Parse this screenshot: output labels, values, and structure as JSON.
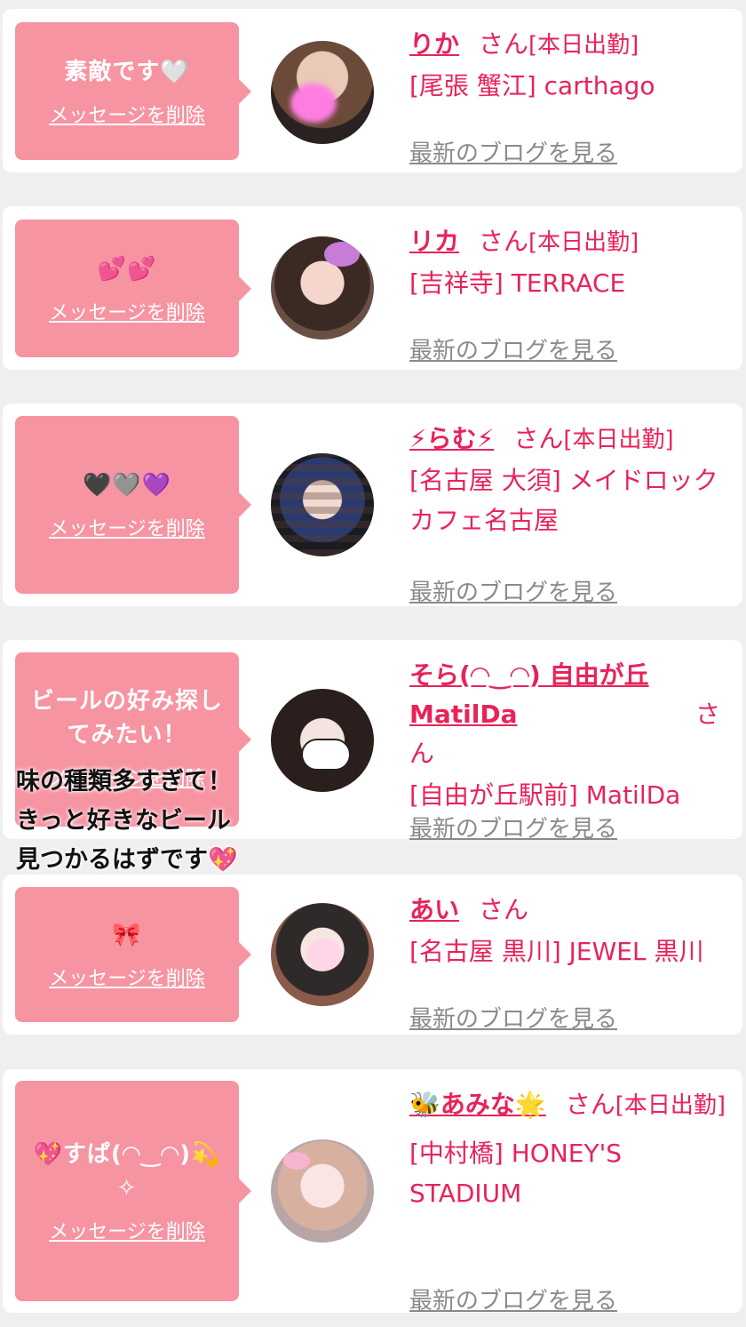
{
  "items": [
    {
      "message": "素敵です🤍",
      "delete_label": "メッセージを削除",
      "name": "りか",
      "san": "さん",
      "shift": "[本日出勤]",
      "shop": "[尾張 蟹江] carthago",
      "blog": "最新のブログを見る"
    },
    {
      "message": "💕💕",
      "delete_label": "メッセージを削除",
      "name": "リカ",
      "san": "さん",
      "shift": "[本日出勤]",
      "shop": "[吉祥寺] TERRACE",
      "blog": "最新のブログを見る"
    },
    {
      "message": "🖤🩶💜",
      "delete_label": "メッセージを削除",
      "name": "⚡らむ⚡",
      "san": "さん",
      "shift": "[本日出勤]",
      "shop": "[名古屋 大須] メイドロックカフェ名古屋",
      "blog": "最新のブログを見る"
    },
    {
      "message": "ビールの好み探してみたい！",
      "delete_label": "メッセージを削除",
      "name": "そら(◠‿◠) 自由が丘MatilDa",
      "san": "さん",
      "shift": "",
      "shop": "[自由が丘駅前] MatilDa",
      "blog": "最新のブログを見る"
    },
    {
      "message": "🎀",
      "delete_label": "メッセージを削除",
      "name": "あい",
      "san": "さん",
      "shift": "",
      "shop": "[名古屋 黒川] JEWEL 黒川",
      "blog": "最新のブログを見る"
    },
    {
      "message": "💖すぱ(◠‿◠)💫 ✧",
      "delete_label": "メッセージを削除",
      "name": "🐝あみな🌟",
      "san": "さん",
      "shift": "[本日出勤]",
      "shop": "[中村橋] HONEY'S STADIUM",
      "blog": "最新のブログを見る"
    }
  ],
  "overlay_text": {
    "line1": "味の種類多すぎて！",
    "line2": "きっと好きなビール",
    "line3": "見つかるはずです💖"
  },
  "colors": {
    "accent": "#e8235a",
    "bubble": "#f694a2",
    "background": "#efefef"
  }
}
